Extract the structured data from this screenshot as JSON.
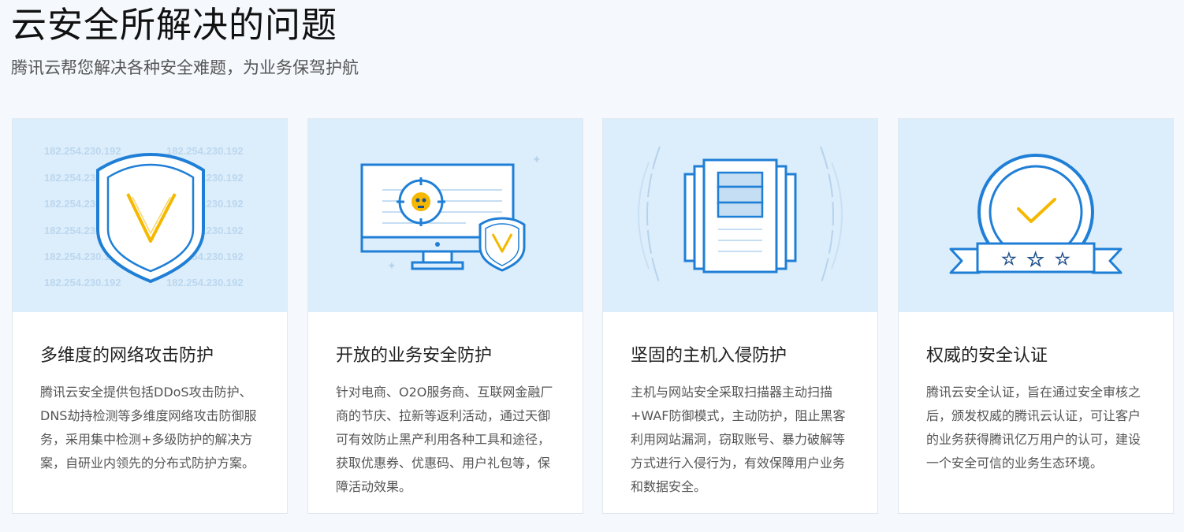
{
  "header": {
    "title": "云安全所解决的问题",
    "subtitle": "腾讯云帮您解决各种安全难题，为业务保驾护航"
  },
  "cards": [
    {
      "title": "多维度的网络攻击防护",
      "description": "腾讯云安全提供包括DDoS攻击防护、DNS劫持检测等多维度网络攻击防御服务，采用集中检测+多级防护的解决方案，自研业内领先的分布式防护方案。",
      "illustration": "shield-icon",
      "ip_text": "182.254.230.192"
    },
    {
      "title": "开放的业务安全防护",
      "description": "针对电商、O2O服务商、互联网金融厂商的节庆、拉新等返利活动，通过天御可有效防止黑产利用各种工具和途径，获取优惠券、优惠码、用户礼包等，保障活动效果。",
      "illustration": "monitor-target-icon"
    },
    {
      "title": "坚固的主机入侵防护",
      "description": "主机与网站安全采取扫描器主动扫描+WAF防御模式，主动防护，阻止黑客利用网站漏洞，窃取账号、暴力破解等方式进行入侵行为，有效保障用户业务和数据安全。",
      "illustration": "server-icon"
    },
    {
      "title": "权威的安全认证",
      "description": "腾讯云安全认证，旨在通过安全审核之后，颁发权威的腾讯云认证，可让客户的业务获得腾讯亿万用户的认可，建设一个安全可信的业务生态环境。",
      "illustration": "certificate-badge-icon"
    }
  ],
  "colors": {
    "page_bg": "#f5f9fd",
    "illustration_bg": "#dceefc",
    "accent_blue": "#1f7fd6",
    "accent_yellow": "#f5b800"
  }
}
